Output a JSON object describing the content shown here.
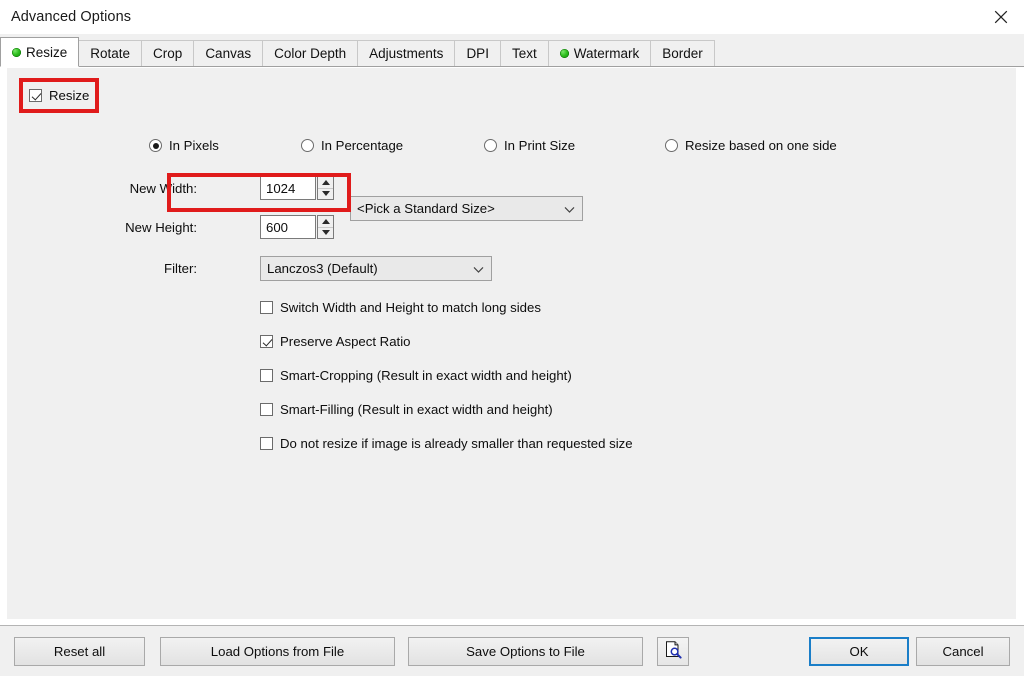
{
  "window": {
    "title": "Advanced Options",
    "close_icon": "close-icon"
  },
  "tabs": [
    {
      "label": "Resize",
      "active": true,
      "dot": true
    },
    {
      "label": "Rotate",
      "active": false,
      "dot": false
    },
    {
      "label": "Crop",
      "active": false,
      "dot": false
    },
    {
      "label": "Canvas",
      "active": false,
      "dot": false
    },
    {
      "label": "Color Depth",
      "active": false,
      "dot": false
    },
    {
      "label": "Adjustments",
      "active": false,
      "dot": false
    },
    {
      "label": "DPI",
      "active": false,
      "dot": false
    },
    {
      "label": "Text",
      "active": false,
      "dot": false
    },
    {
      "label": "Watermark",
      "active": false,
      "dot": true
    },
    {
      "label": "Border",
      "active": false,
      "dot": false
    }
  ],
  "resize": {
    "enable_label": "Resize",
    "enable_checked": true,
    "modes": [
      {
        "label": "In Pixels",
        "selected": true
      },
      {
        "label": "In Percentage",
        "selected": false
      },
      {
        "label": "In Print Size",
        "selected": false
      },
      {
        "label": "Resize based on one side",
        "selected": false
      }
    ],
    "width_label": "New Width:",
    "width_value": "1024",
    "height_label": "New Height:",
    "height_value": "600",
    "standard_size_value": "<Pick a Standard Size>",
    "filter_label": "Filter:",
    "filter_value": "Lanczos3 (Default)",
    "options": [
      {
        "label": "Switch Width and Height to match long sides",
        "checked": false
      },
      {
        "label": "Preserve Aspect Ratio",
        "checked": true
      },
      {
        "label": "Smart-Cropping (Result in exact width and height)",
        "checked": false
      },
      {
        "label": "Smart-Filling (Result in exact width and height)",
        "checked": false
      },
      {
        "label": "Do not resize if image is already smaller than requested size",
        "checked": false
      }
    ]
  },
  "footer": {
    "reset_all": "Reset all",
    "load_options": "Load Options from File",
    "save_options": "Save Options to File",
    "preview_icon": "document-magnifier-icon",
    "ok": "OK",
    "cancel": "Cancel"
  },
  "colors": {
    "highlight": "#e01b1b",
    "focus": "#1a7ec8",
    "panel": "#f0f0f0",
    "status_dot": "#2fbf1f"
  }
}
